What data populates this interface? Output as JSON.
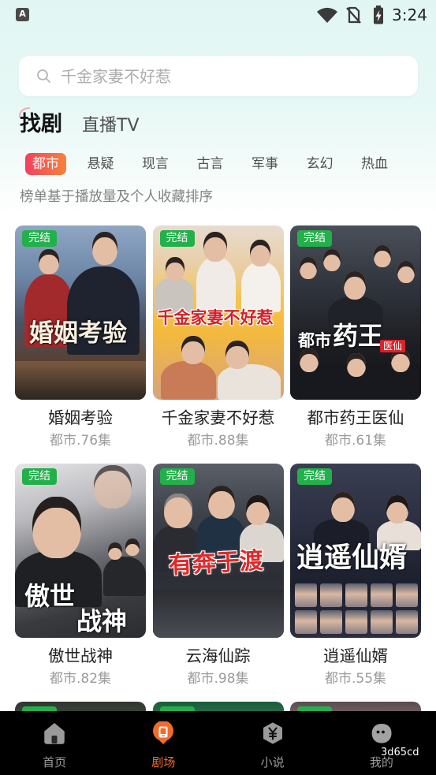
{
  "status_bar": {
    "app_icon_letter": "A",
    "time": "3:24",
    "icons": {
      "wifi": "wifi-icon",
      "sim": "no-sim-icon",
      "battery": "battery-charging-icon"
    }
  },
  "search": {
    "placeholder": "千金家妻不好惹",
    "icon": "search-icon"
  },
  "tabs": [
    {
      "label": "找剧",
      "active": true
    },
    {
      "label": "直播TV",
      "active": false
    }
  ],
  "categories": [
    {
      "label": "都市",
      "selected": true
    },
    {
      "label": "悬疑",
      "selected": false
    },
    {
      "label": "现言",
      "selected": false
    },
    {
      "label": "古言",
      "selected": false
    },
    {
      "label": "军事",
      "selected": false
    },
    {
      "label": "玄幻",
      "selected": false
    },
    {
      "label": "热血",
      "selected": false
    }
  ],
  "ranking_note": "榜单基于播放量及个人收藏排序",
  "dramas": [
    {
      "title": "婚姻考验",
      "meta": "都市.76集",
      "badge": "完结",
      "poster_lines": [
        "婚姻考验"
      ]
    },
    {
      "title": "千金家妻不好惹",
      "meta": "都市.88集",
      "badge": "完结",
      "poster_lines": [
        "千金家妻不好惹"
      ]
    },
    {
      "title": "都市药王医仙",
      "meta": "都市.61集",
      "badge": "完结",
      "poster_lines": [
        "都市",
        "药王"
      ],
      "poster_tag": "医仙"
    },
    {
      "title": "傲世战神",
      "meta": "都市.82集",
      "badge": "完结",
      "poster_lines": [
        "傲世",
        "战神"
      ]
    },
    {
      "title": "云海仙踪",
      "meta": "都市.98集",
      "badge": "完结",
      "poster_lines": [
        "有奔于渡"
      ]
    },
    {
      "title": "逍遥仙婿",
      "meta": "都市.55集",
      "badge": "完结",
      "poster_lines": [
        "逍遥仙婿"
      ]
    }
  ],
  "bottom_nav": [
    {
      "label": "首页",
      "icon": "home-icon",
      "active": false
    },
    {
      "label": "剧场",
      "icon": "theater-icon",
      "active": true
    },
    {
      "label": "小说",
      "icon": "novel-icon",
      "active": false
    },
    {
      "label": "我的",
      "icon": "profile-icon",
      "active": false
    }
  ],
  "watermark": "3d65cd",
  "colors": {
    "accent": "#f26b2a",
    "badge_green": "#22b04a",
    "chip_gradient_start": "#f4405f",
    "chip_gradient_end": "#f7823a",
    "nav_background": "#000000"
  }
}
